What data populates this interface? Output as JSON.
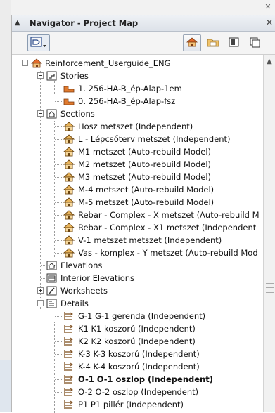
{
  "palette": {
    "title": "Navigator - Project Map",
    "toolbar": {
      "buttons": [
        {
          "name": "project-map-icon",
          "active": true
        },
        {
          "name": "view-map-icon",
          "active": false
        },
        {
          "name": "layout-book-icon",
          "active": false
        },
        {
          "name": "publisher-sets-icon",
          "active": false
        }
      ]
    }
  },
  "tree": {
    "root": "Reinforcement_Userguide_ENG",
    "stories": {
      "label": "Stories",
      "items": [
        "1. 256-HA-B_ép-Alap-1em",
        "0. 256-HA-B_ép-Alap-fsz"
      ]
    },
    "sections": {
      "label": "Sections",
      "items": [
        "Hosz metszet (Independent)",
        "L - Lépcsőterv metszet (Independent)",
        "M1 metszet (Auto-rebuild Model)",
        "M2 metszet (Auto-rebuild Model)",
        "M3 metszet (Auto-rebuild Model)",
        "M-4 metszet (Auto-rebuild Model)",
        "M-5 metszet (Auto-rebuild Model)",
        "Rebar - Complex - X metszet (Auto-rebuild M",
        "Rebar - Complex - X1 metszet (Independent",
        "V-1 metszet metszet (Independent)",
        "Vas - komplex - Y metszet (Auto-rebuild Mod"
      ]
    },
    "elevations": "Elevations",
    "interior_elevations": "Interior Elevations",
    "worksheets": "Worksheets",
    "details": {
      "label": "Details",
      "items": [
        "G-1 G-1 gerenda (Independent)",
        "K1 K1 koszorú (Independent)",
        "K2 K2 koszorú (Independent)",
        "K-3 K-3 koszorú (Independent)",
        "K-4 K-4 koszorú (Independent)",
        "O-1 O-1 oszlop (Independent)",
        "O-2 O-2 oszlop (Independent)",
        "P1 P1 pillér (Independent)"
      ],
      "selected": "O-1 O-1 oszlop (Independent)"
    }
  },
  "colors": {
    "story_icon": "#e07a2e",
    "house_icon": "#c9862a",
    "accent": "#8a9bb0"
  }
}
